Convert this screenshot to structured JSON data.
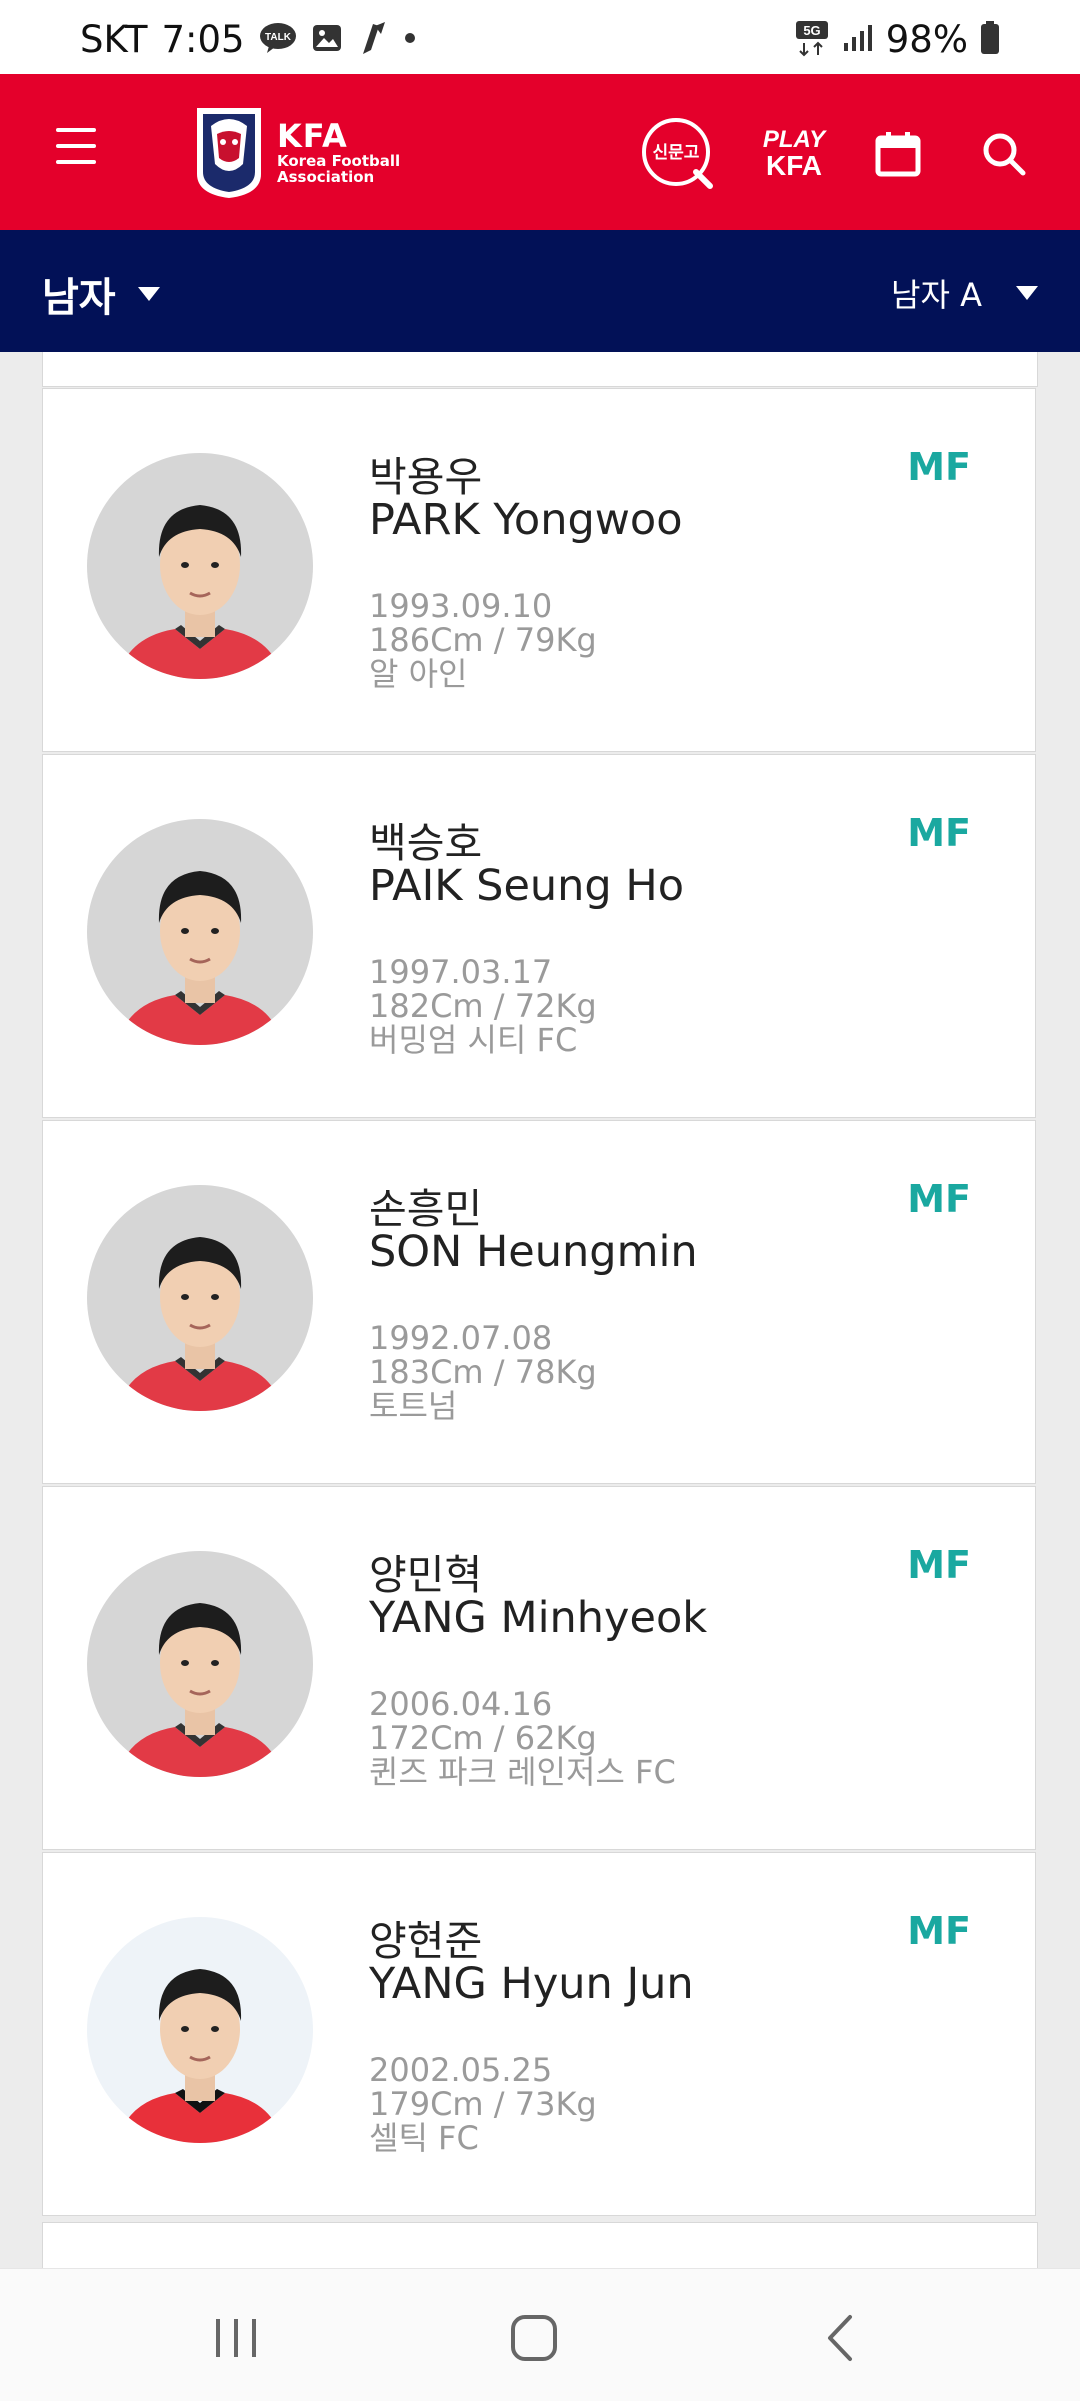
{
  "status_bar": {
    "carrier": "SKT",
    "time": "7:05",
    "network": "5G",
    "battery": "98%"
  },
  "header": {
    "logo": {
      "title": "KFA",
      "subtitle_line1": "Korea Football",
      "subtitle_line2": "Association"
    },
    "sinmungo_label": "신문고",
    "playkfa_line1": "PLAY",
    "playkfa_line2": "KFA"
  },
  "filters": {
    "gender": "남자",
    "team": "남자 A"
  },
  "players": [
    {
      "name_kr": "박용우",
      "name_en": "PARK Yongwoo",
      "position": "MF",
      "birth": "1993.09.10",
      "body": "186Cm / 79Kg",
      "club": "알 아인"
    },
    {
      "name_kr": "백승호",
      "name_en": "PAIK Seung Ho",
      "position": "MF",
      "birth": "1997.03.17",
      "body": "182Cm / 72Kg",
      "club": "버밍엄 시티 FC"
    },
    {
      "name_kr": "손흥민",
      "name_en": "SON Heungmin",
      "position": "MF",
      "birth": "1992.07.08",
      "body": "183Cm / 78Kg",
      "club": "토트넘"
    },
    {
      "name_kr": "양민혁",
      "name_en": "YANG Minhyeok",
      "position": "MF",
      "birth": "2006.04.16",
      "body": "172Cm / 62Kg",
      "club": "퀸즈 파크 레인저스 FC"
    },
    {
      "name_kr": "양현준",
      "name_en": "YANG Hyun Jun",
      "position": "MF",
      "birth": "2002.05.25",
      "body": "179Cm / 73Kg",
      "club": "셀틱 FC"
    }
  ],
  "colors": {
    "header_red": "#e4002b",
    "nav_navy": "#021157",
    "position_teal": "#1aa8a0",
    "meta_gray": "#9a9a9a"
  },
  "icons": {
    "menu": "hamburger-icon",
    "calendar": "calendar-icon",
    "search": "search-icon",
    "dropdown": "triangle-down-icon",
    "recent": "recent-apps-icon",
    "home": "home-icon",
    "back": "back-icon"
  }
}
